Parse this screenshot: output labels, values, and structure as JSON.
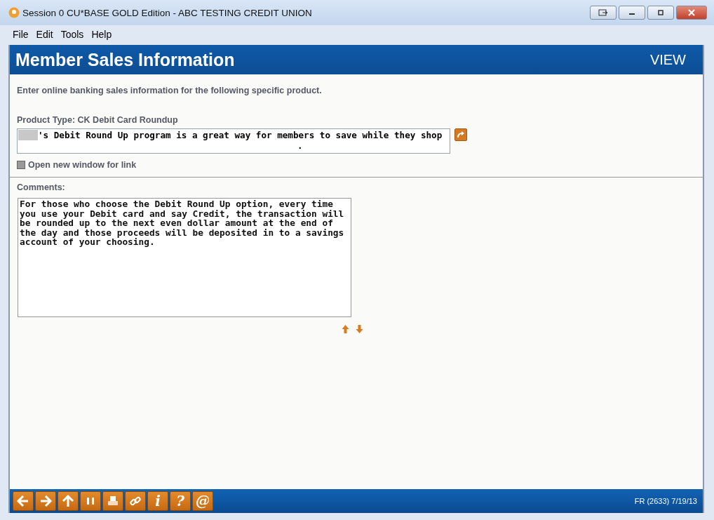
{
  "window": {
    "title": "Session 0 CU*BASE GOLD Edition - ABC TESTING CREDIT UNION"
  },
  "menu": [
    "File",
    "Edit",
    "Tools",
    "Help"
  ],
  "header": {
    "title": "Member Sales Information",
    "mode": "VIEW"
  },
  "intro": "Enter online banking sales information for the following specific product.",
  "product_type": "Product Type: CK Debit Card Roundup",
  "link_field": {
    "line_1": "'s Debit Round Up program is a great way for members to save while they shop",
    "line_2": "."
  },
  "open_new_window": {
    "label": "Open new window for link",
    "checked": false
  },
  "comments": {
    "label": "Comments:",
    "value": "For those who choose the Debit Round Up option, every time\nyou use your Debit card and say Credit, the transaction will\nbe rounded up to the next even dollar amount at the end of\nthe day and those proceeds will be deposited in to a savings\naccount of your choosing."
  },
  "toolbar": [
    {
      "kind": "back"
    },
    {
      "kind": "forward"
    },
    {
      "kind": "up"
    },
    {
      "kind": "pause"
    },
    {
      "kind": "print"
    },
    {
      "kind": "link"
    },
    {
      "kind": "glyph",
      "label": "i"
    },
    {
      "kind": "glyph",
      "label": "?"
    },
    {
      "kind": "glyph",
      "label": "@"
    }
  ],
  "status": "FR (2633) 7/19/13"
}
